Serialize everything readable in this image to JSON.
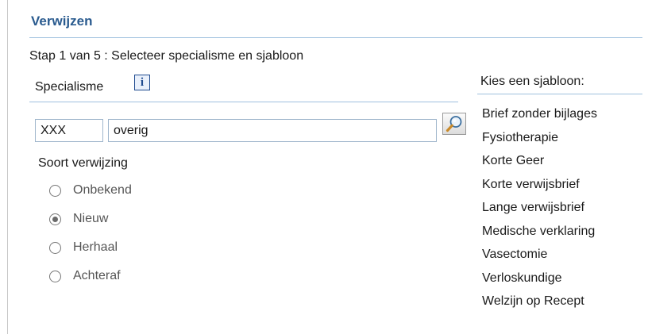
{
  "header": {
    "title": "Verwijzen"
  },
  "step": {
    "text": "Stap 1 van 5 : Selecteer specialisme en sjabloon"
  },
  "specialisme": {
    "label": "Specialisme",
    "code_value": "XXX",
    "name_value": "overig"
  },
  "icons": {
    "info": "info-icon",
    "search": "magnifier-icon"
  },
  "soort": {
    "label": "Soort verwijzing",
    "options": [
      {
        "label": "Onbekend",
        "checked": false
      },
      {
        "label": "Nieuw",
        "checked": true
      },
      {
        "label": "Herhaal",
        "checked": false
      },
      {
        "label": "Achteraf",
        "checked": false
      }
    ]
  },
  "sjabloon": {
    "label": "Kies een sjabloon:",
    "items": [
      "Brief zonder bijlages",
      "Fysiotherapie",
      "Korte Geer",
      "Korte verwijsbrief",
      "Lange verwijsbrief",
      "Medische verklaring",
      "Vasectomie",
      "Verloskundige",
      "Welzijn op Recept"
    ]
  },
  "colors": {
    "title": "#2a5b8f",
    "rule": "#9fc0de",
    "info_blue": "#1f4b8f"
  }
}
